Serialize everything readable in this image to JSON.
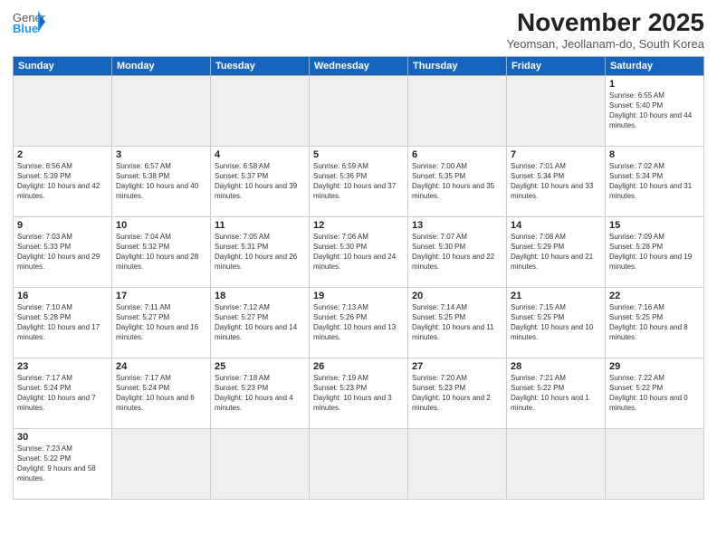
{
  "header": {
    "logo_general": "General",
    "logo_blue": "Blue",
    "month_title": "November 2025",
    "location": "Yeomsan, Jeollanam-do, South Korea"
  },
  "days_of_week": [
    "Sunday",
    "Monday",
    "Tuesday",
    "Wednesday",
    "Thursday",
    "Friday",
    "Saturday"
  ],
  "weeks": [
    [
      {
        "day": "",
        "empty": true
      },
      {
        "day": "",
        "empty": true
      },
      {
        "day": "",
        "empty": true
      },
      {
        "day": "",
        "empty": true
      },
      {
        "day": "",
        "empty": true
      },
      {
        "day": "",
        "empty": true
      },
      {
        "day": "1",
        "sunrise": "6:55 AM",
        "sunset": "5:40 PM",
        "daylight": "10 hours and 44 minutes."
      }
    ],
    [
      {
        "day": "2",
        "sunrise": "6:56 AM",
        "sunset": "5:39 PM",
        "daylight": "10 hours and 42 minutes."
      },
      {
        "day": "3",
        "sunrise": "6:57 AM",
        "sunset": "5:38 PM",
        "daylight": "10 hours and 40 minutes."
      },
      {
        "day": "4",
        "sunrise": "6:58 AM",
        "sunset": "5:37 PM",
        "daylight": "10 hours and 39 minutes."
      },
      {
        "day": "5",
        "sunrise": "6:59 AM",
        "sunset": "5:36 PM",
        "daylight": "10 hours and 37 minutes."
      },
      {
        "day": "6",
        "sunrise": "7:00 AM",
        "sunset": "5:35 PM",
        "daylight": "10 hours and 35 minutes."
      },
      {
        "day": "7",
        "sunrise": "7:01 AM",
        "sunset": "5:34 PM",
        "daylight": "10 hours and 33 minutes."
      },
      {
        "day": "8",
        "sunrise": "7:02 AM",
        "sunset": "5:34 PM",
        "daylight": "10 hours and 31 minutes."
      }
    ],
    [
      {
        "day": "9",
        "sunrise": "7:03 AM",
        "sunset": "5:33 PM",
        "daylight": "10 hours and 29 minutes."
      },
      {
        "day": "10",
        "sunrise": "7:04 AM",
        "sunset": "5:32 PM",
        "daylight": "10 hours and 28 minutes."
      },
      {
        "day": "11",
        "sunrise": "7:05 AM",
        "sunset": "5:31 PM",
        "daylight": "10 hours and 26 minutes."
      },
      {
        "day": "12",
        "sunrise": "7:06 AM",
        "sunset": "5:30 PM",
        "daylight": "10 hours and 24 minutes."
      },
      {
        "day": "13",
        "sunrise": "7:07 AM",
        "sunset": "5:30 PM",
        "daylight": "10 hours and 22 minutes."
      },
      {
        "day": "14",
        "sunrise": "7:08 AM",
        "sunset": "5:29 PM",
        "daylight": "10 hours and 21 minutes."
      },
      {
        "day": "15",
        "sunrise": "7:09 AM",
        "sunset": "5:28 PM",
        "daylight": "10 hours and 19 minutes."
      }
    ],
    [
      {
        "day": "16",
        "sunrise": "7:10 AM",
        "sunset": "5:28 PM",
        "daylight": "10 hours and 17 minutes."
      },
      {
        "day": "17",
        "sunrise": "7:11 AM",
        "sunset": "5:27 PM",
        "daylight": "10 hours and 16 minutes."
      },
      {
        "day": "18",
        "sunrise": "7:12 AM",
        "sunset": "5:27 PM",
        "daylight": "10 hours and 14 minutes."
      },
      {
        "day": "19",
        "sunrise": "7:13 AM",
        "sunset": "5:26 PM",
        "daylight": "10 hours and 13 minutes."
      },
      {
        "day": "20",
        "sunrise": "7:14 AM",
        "sunset": "5:25 PM",
        "daylight": "10 hours and 11 minutes."
      },
      {
        "day": "21",
        "sunrise": "7:15 AM",
        "sunset": "5:25 PM",
        "daylight": "10 hours and 10 minutes."
      },
      {
        "day": "22",
        "sunrise": "7:16 AM",
        "sunset": "5:25 PM",
        "daylight": "10 hours and 8 minutes."
      }
    ],
    [
      {
        "day": "23",
        "sunrise": "7:17 AM",
        "sunset": "5:24 PM",
        "daylight": "10 hours and 7 minutes."
      },
      {
        "day": "24",
        "sunrise": "7:17 AM",
        "sunset": "5:24 PM",
        "daylight": "10 hours and 6 minutes."
      },
      {
        "day": "25",
        "sunrise": "7:18 AM",
        "sunset": "5:23 PM",
        "daylight": "10 hours and 4 minutes."
      },
      {
        "day": "26",
        "sunrise": "7:19 AM",
        "sunset": "5:23 PM",
        "daylight": "10 hours and 3 minutes."
      },
      {
        "day": "27",
        "sunrise": "7:20 AM",
        "sunset": "5:23 PM",
        "daylight": "10 hours and 2 minutes."
      },
      {
        "day": "28",
        "sunrise": "7:21 AM",
        "sunset": "5:22 PM",
        "daylight": "10 hours and 1 minute."
      },
      {
        "day": "29",
        "sunrise": "7:22 AM",
        "sunset": "5:22 PM",
        "daylight": "10 hours and 0 minutes."
      }
    ],
    [
      {
        "day": "30",
        "sunrise": "7:23 AM",
        "sunset": "5:22 PM",
        "daylight": "9 hours and 58 minutes."
      },
      {
        "day": "",
        "empty": true
      },
      {
        "day": "",
        "empty": true
      },
      {
        "day": "",
        "empty": true
      },
      {
        "day": "",
        "empty": true
      },
      {
        "day": "",
        "empty": true
      },
      {
        "day": "",
        "empty": true
      }
    ]
  ]
}
